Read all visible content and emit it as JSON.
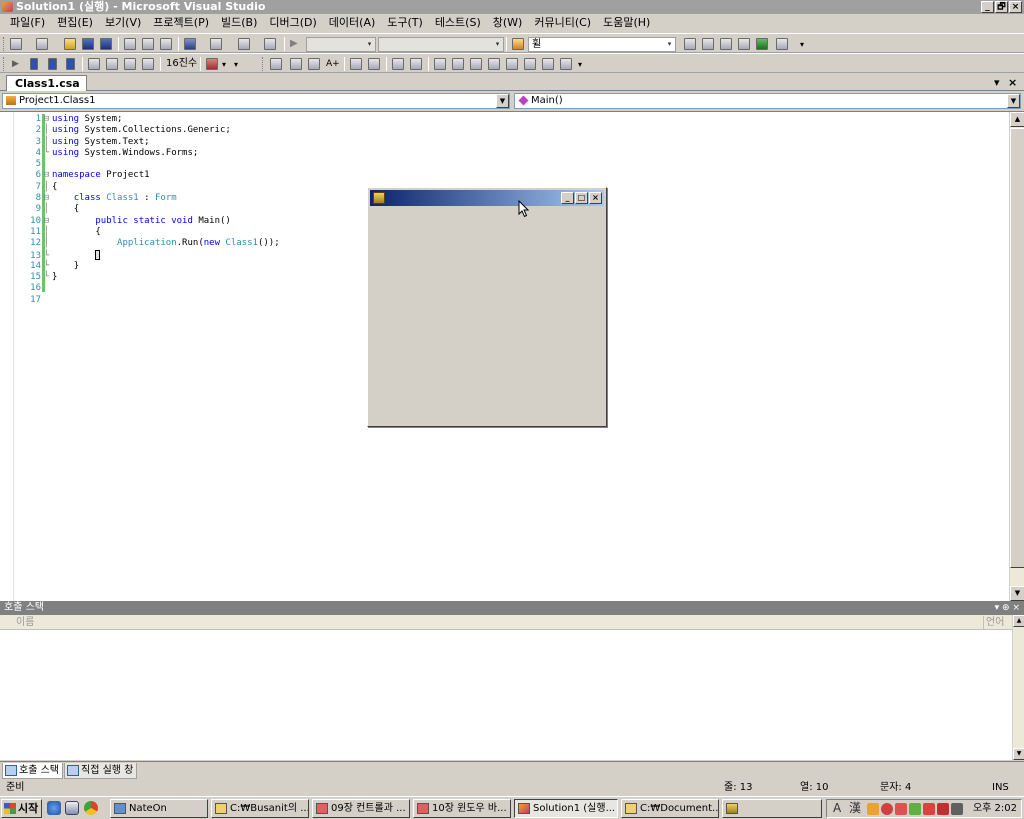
{
  "window": {
    "title": "Solution1 (실행) - Microsoft Visual Studio",
    "min_label": "_",
    "max_label": "🗗",
    "close_label": "×"
  },
  "menu": {
    "items": [
      "파일(F)",
      "편집(E)",
      "보기(V)",
      "프로젝트(P)",
      "빌드(B)",
      "디버그(D)",
      "데이터(A)",
      "도구(T)",
      "테스트(S)",
      "창(W)",
      "커뮤니티(C)",
      "도움말(H)"
    ]
  },
  "toolbar": {
    "find_combo_value": "휠",
    "hex_label": "16진수"
  },
  "document": {
    "tab_label": "Class1.csa",
    "tab_menu": "▾",
    "tab_close": "×",
    "class_combo": "Project1.Class1",
    "member_combo": "Main()"
  },
  "code": {
    "line_numbers": [
      "1",
      "2",
      "3",
      "4",
      "5",
      "6",
      "7",
      "8",
      "9",
      "10",
      "11",
      "12",
      "13",
      "14",
      "15",
      "16",
      "17"
    ],
    "line1_kw": "using",
    "line1_rest": " System;",
    "line2_kw": "using",
    "line2_rest": " System.Collections.Generic;",
    "line3_kw": "using",
    "line3_rest": " System.Text;",
    "line4_kw": "using",
    "line4_rest": " System.Windows.Forms;",
    "line6_kw": "namespace",
    "line6_rest": " Project1",
    "line7": "{",
    "line8_kw": "class",
    "line8_type": "Class1",
    "line8_sep": " : ",
    "line8_base": "Form",
    "line9": "{",
    "line10_kw": "public static void",
    "line10_rest": " Main()",
    "line11": "{",
    "line12_type": "Application",
    "line12_mid": ".Run(",
    "line12_kw": "new",
    "line12_cls": "Class1",
    "line12_end": "());",
    "line14": "}",
    "line15": "}"
  },
  "running_form": {
    "min_label": "_",
    "max_label": "□",
    "close_label": "×"
  },
  "call_stack": {
    "title": "호출 스택",
    "controls": "▾ ⊕ ×",
    "col_name": "이름",
    "col_lang": "언어"
  },
  "pane_tabs": [
    "호출 스택",
    "직접 실행 창"
  ],
  "status": {
    "ready": "준비",
    "line": "줄: 13",
    "col": "열: 10",
    "char": "문자: 4",
    "mode": "INS"
  },
  "taskbar": {
    "start_label": "시작",
    "buttons": [
      "NateOn",
      "C:₩Busanit의 ...",
      "09장 컨트롤과 ...",
      "10장 윈도우 바...",
      "Solution1 (실행...",
      "C:₩Document..."
    ],
    "ime_a": "A",
    "ime_han": "漢",
    "clock": "오후 2:02"
  },
  "colors": {
    "title_gradient_start": "#0a246a",
    "title_gradient_end": "#a6caf0",
    "keyword": "#0000ff",
    "type": "#2b91af",
    "change_bar": "#6cc36c"
  }
}
